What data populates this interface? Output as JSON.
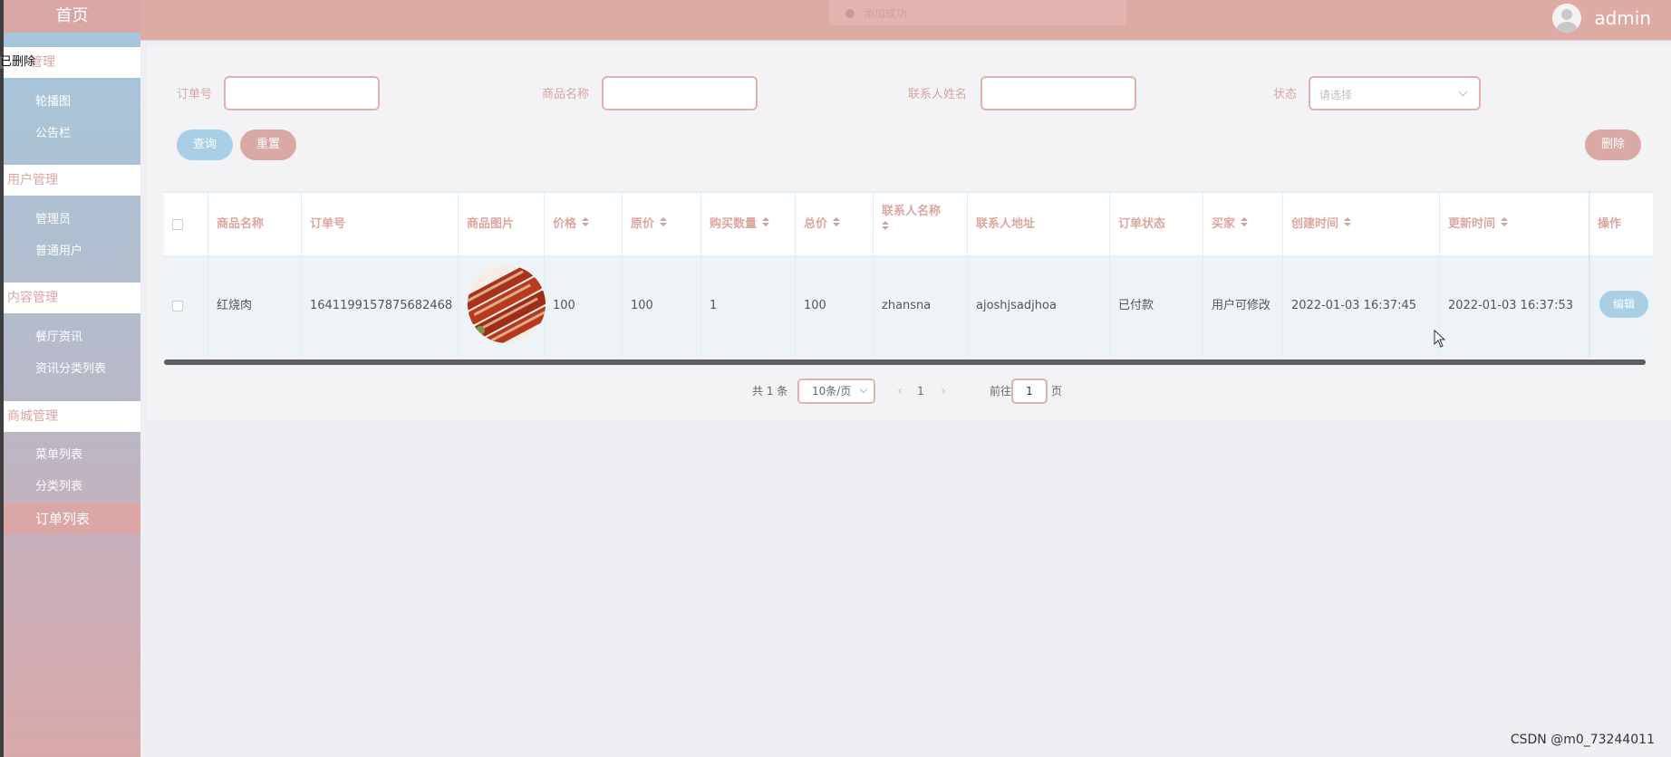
{
  "header": {
    "toast": "添加成功",
    "username": "admin"
  },
  "sidebar": {
    "home": "首页",
    "overlap_text": "已删除",
    "groups": [
      {
        "label": "管理",
        "items": [
          "轮播图",
          "公告栏"
        ]
      },
      {
        "label": "用户管理",
        "items": [
          "管理员",
          "普通用户"
        ]
      },
      {
        "label": "内容管理",
        "items": [
          "餐厅资讯",
          "资讯分类列表"
        ]
      },
      {
        "label": "商城管理",
        "items": [
          "菜单列表",
          "分类列表",
          "订单列表"
        ]
      }
    ],
    "active_item": "订单列表"
  },
  "filters": {
    "order_no_label": "订单号",
    "product_name_label": "商品名称",
    "contact_name_label": "联系人姓名",
    "status_label": "状态",
    "status_placeholder": "请选择",
    "order_no_value": "",
    "product_name_value": "",
    "contact_name_value": ""
  },
  "buttons": {
    "query": "查询",
    "reset": "重置",
    "delete": "删除",
    "edit": "编辑"
  },
  "table": {
    "columns": [
      "商品名称",
      "订单号",
      "商品图片",
      "价格",
      "原价",
      "购买数量",
      "总价",
      "联系人名称",
      "联系人地址",
      "订单状态",
      "买家",
      "创建时间",
      "更新时间",
      "操作"
    ],
    "rows": [
      {
        "product_name": "红烧肉",
        "order_no": "1641199157875682468",
        "image": "braised-pork-image",
        "price": "100",
        "original_price": "100",
        "quantity": "1",
        "total": "100",
        "contact_name": "zhansna",
        "contact_address": "ajoshjsadjhoa",
        "status": "已付款",
        "buyer": "用户可修改",
        "created": "2022-01-03 16:37:45",
        "updated": "2022-01-03 16:37:53"
      }
    ]
  },
  "pagination": {
    "total": "共 1 条",
    "page_size": "10条/页",
    "current_page": "1",
    "goto_label": "前往",
    "goto_value": "1",
    "page_suffix": "页"
  },
  "watermark": "CSDN @m0_73244011",
  "colors": {
    "accent_pink": "#d9a7a3",
    "accent_blue": "#a9cfe6"
  }
}
